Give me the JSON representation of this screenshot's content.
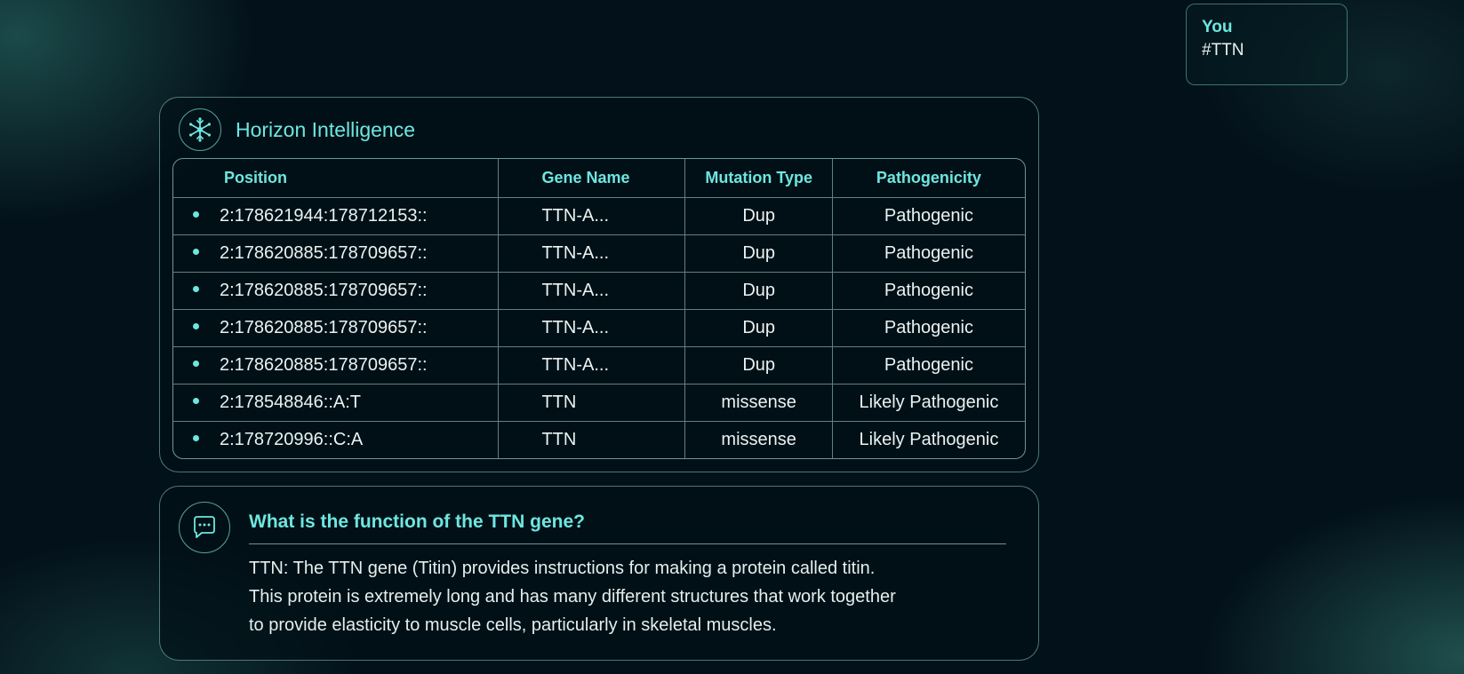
{
  "user_message": {
    "sender": "You",
    "text": "#TTN"
  },
  "results_card": {
    "title": "Horizon Intelligence",
    "icon": "network-snowflake-icon",
    "columns": [
      "Position",
      "Gene Name",
      "Mutation Type",
      "Pathogenicity"
    ],
    "rows": [
      {
        "position": "2:178621944:178712153::",
        "gene": "TTN-A...",
        "mutation": "Dup",
        "pathogenicity": "Pathogenic"
      },
      {
        "position": "2:178620885:178709657::",
        "gene": "TTN-A...",
        "mutation": "Dup",
        "pathogenicity": "Pathogenic"
      },
      {
        "position": "2:178620885:178709657::",
        "gene": "TTN-A...",
        "mutation": "Dup",
        "pathogenicity": "Pathogenic"
      },
      {
        "position": "2:178620885:178709657::",
        "gene": "TTN-A...",
        "mutation": "Dup",
        "pathogenicity": "Pathogenic"
      },
      {
        "position": "2:178620885:178709657::",
        "gene": "TTN-A...",
        "mutation": "Dup",
        "pathogenicity": "Pathogenic"
      },
      {
        "position": "2:178548846::A:T",
        "gene": "TTN",
        "mutation": "missense",
        "pathogenicity": "Likely Pathogenic"
      },
      {
        "position": "2:178720996::C:A",
        "gene": "TTN",
        "mutation": "missense",
        "pathogenicity": "Likely Pathogenic"
      }
    ]
  },
  "answer_card": {
    "icon": "chat-bubble-icon",
    "question": "What is the function of the TTN gene?",
    "lines": [
      "TTN: The TTN gene (Titin) provides instructions for making a protein called titin.",
      "This protein is extremely long and has many different structures that work together",
      "to provide elasticity to muscle cells, particularly in skeletal muscles."
    ]
  },
  "colors": {
    "accent": "#6ee6e0",
    "background": "#03111a",
    "text": "#eaf3f2"
  }
}
